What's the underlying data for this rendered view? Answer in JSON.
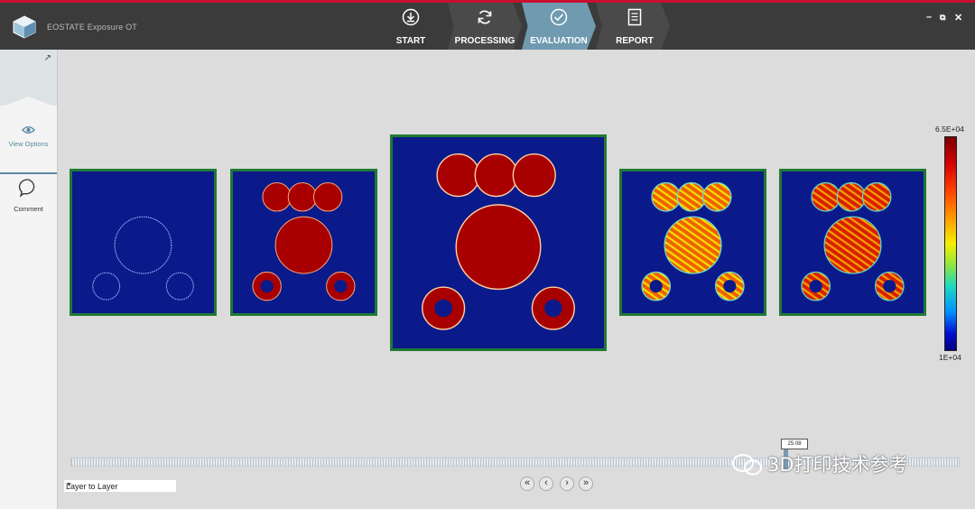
{
  "app": {
    "title": "EOSTATE Exposure OT"
  },
  "steps": [
    {
      "label": "START",
      "icon": "download-icon"
    },
    {
      "label": "PROCESSING",
      "icon": "refresh-icon"
    },
    {
      "label": "EVALUATION",
      "icon": "check-circle-icon",
      "active": true
    },
    {
      "label": "REPORT",
      "icon": "document-icon"
    }
  ],
  "window_controls": {
    "minimize": "–",
    "restore": "⧉",
    "close": "✕"
  },
  "sidebar": {
    "items": [
      {
        "label": "View Options",
        "icon": "eye-icon",
        "active": true
      },
      {
        "label": "Comment",
        "icon": "speech-bubble-icon"
      }
    ]
  },
  "colorbar": {
    "max_label": "6.5E+04",
    "min_label": "1E+04"
  },
  "slider": {
    "value_label": "25.08"
  },
  "mode_select": {
    "value": "Layer to Layer"
  },
  "nav": {
    "first": "«",
    "prev": "‹",
    "next": "›",
    "last": "»"
  },
  "watermark": {
    "text": "3D打印技术参考"
  },
  "colors": {
    "accent": "#6f9ab0",
    "panel_border": "#1f7a33",
    "panel_bg": "#0b1a8a",
    "topbar": "#3b3b3b"
  }
}
